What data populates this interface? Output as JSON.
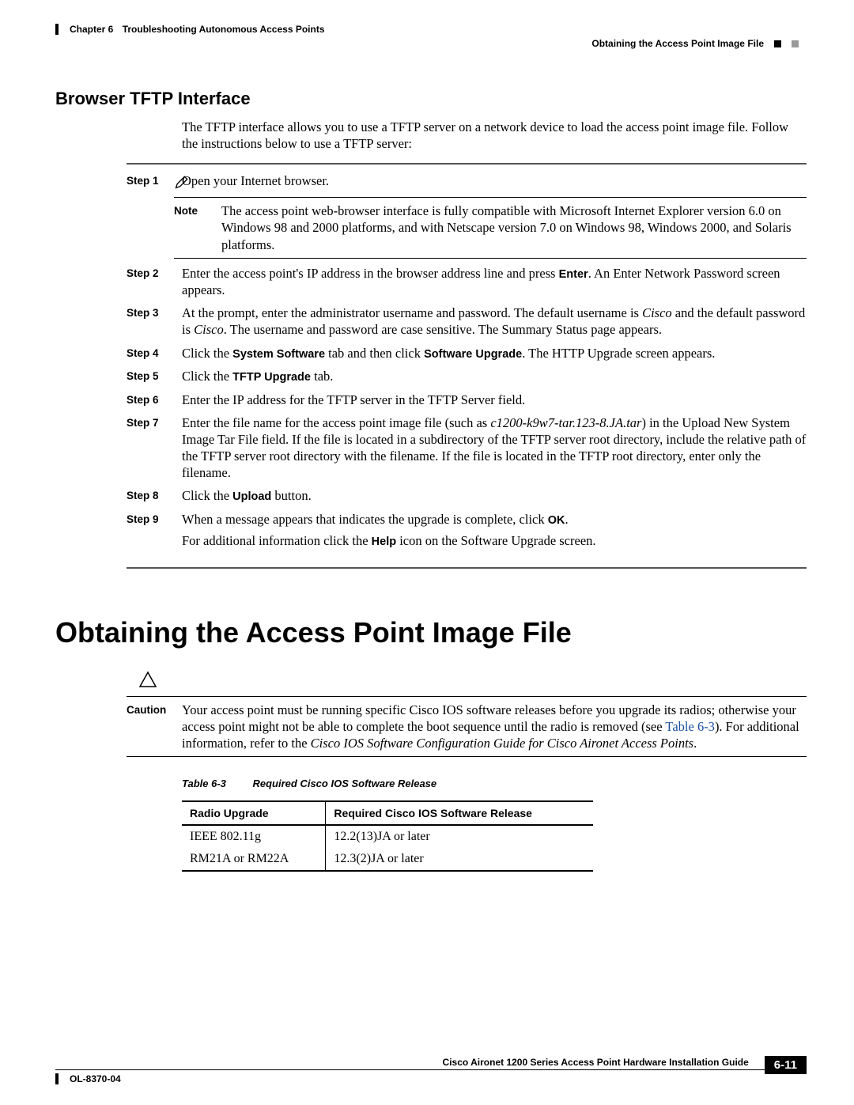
{
  "header": {
    "chapter_label": "Chapter 6",
    "chapter_title": "Troubleshooting Autonomous Access Points",
    "section_title": "Obtaining the Access Point Image File"
  },
  "section_heading": "Browser TFTP Interface",
  "intro_text": "The TFTP interface allows you to use a TFTP server on a network device to load the access point image file. Follow the instructions below to use a TFTP server:",
  "steps": {
    "s1_label": "Step 1",
    "s1_body": "Open your Internet browser.",
    "note_label": "Note",
    "note_body": "The access point web-browser interface is fully compatible with Microsoft Internet Explorer version 6.0 on Windows 98 and 2000 platforms, and with Netscape version 7.0 on Windows 98, Windows 2000, and Solaris platforms.",
    "s2_label": "Step 2",
    "s2_pre": "Enter the access point's IP address in the browser address line and press ",
    "s2_bold": "Enter",
    "s2_post": ". An Enter Network Password screen appears.",
    "s3_label": "Step 3",
    "s3_pre": "At the prompt, enter the administrator username and password. The default username is ",
    "s3_it1": "Cisco",
    "s3_mid": " and the default password is ",
    "s3_it2": "Cisco",
    "s3_post": ". The username and password are case sensitive. The Summary Status page appears.",
    "s4_label": "Step 4",
    "s4_pre": "Click the ",
    "s4_b1": "System Software",
    "s4_mid": " tab and then click ",
    "s4_b2": "Software Upgrade",
    "s4_post": ". The HTTP Upgrade screen appears.",
    "s5_label": "Step 5",
    "s5_pre": "Click the ",
    "s5_b1": "TFTP Upgrade",
    "s5_post": " tab.",
    "s6_label": "Step 6",
    "s6_body": "Enter the IP address for the TFTP server in the TFTP Server field.",
    "s7_label": "Step 7",
    "s7_pre": "Enter the file name for the access point image file (such as ",
    "s7_it": "c1200-k9w7-tar.123-8.JA.tar",
    "s7_post": ") in the Upload New System Image Tar File field. If the file is located in a subdirectory of the TFTP server root directory, include the relative path of the TFTP server root directory with the filename. If the file is located in the TFTP root directory, enter only the filename.",
    "s8_label": "Step 8",
    "s8_pre": "Click the ",
    "s8_b1": "Upload",
    "s8_post": " button.",
    "s9_label": "Step 9",
    "s9_pre": "When a message appears that indicates the upgrade is complete, click ",
    "s9_b1": "OK",
    "s9_post": ".",
    "addl_pre": "For additional information click the ",
    "addl_b": "Help",
    "addl_post": " icon on the Software Upgrade screen."
  },
  "main_heading": "Obtaining the Access Point Image File",
  "caution": {
    "label": "Caution",
    "pre": "Your access point must be running specific Cisco IOS software releases before you upgrade its radios; otherwise your access point might not be able to complete the boot sequence until the radio is removed (see ",
    "link": "Table 6-3",
    "mid": "). For additional information, refer to the ",
    "it": "Cisco IOS Software Configuration Guide for Cisco Aironet Access Points",
    "post": "."
  },
  "table_caption": {
    "num": "Table 6-3",
    "title": "Required Cisco IOS Software Release"
  },
  "table": {
    "h1": "Radio Upgrade",
    "h2": "Required Cisco IOS Software Release",
    "r1c1": "IEEE 802.11g",
    "r1c2": "12.2(13)JA or later",
    "r2c1": "RM21A or RM22A",
    "r2c2": "12.3(2)JA or later"
  },
  "footer": {
    "guide": "Cisco Aironet 1200 Series Access Point Hardware Installation Guide",
    "page": "6-11",
    "doc": "OL-8370-04"
  }
}
